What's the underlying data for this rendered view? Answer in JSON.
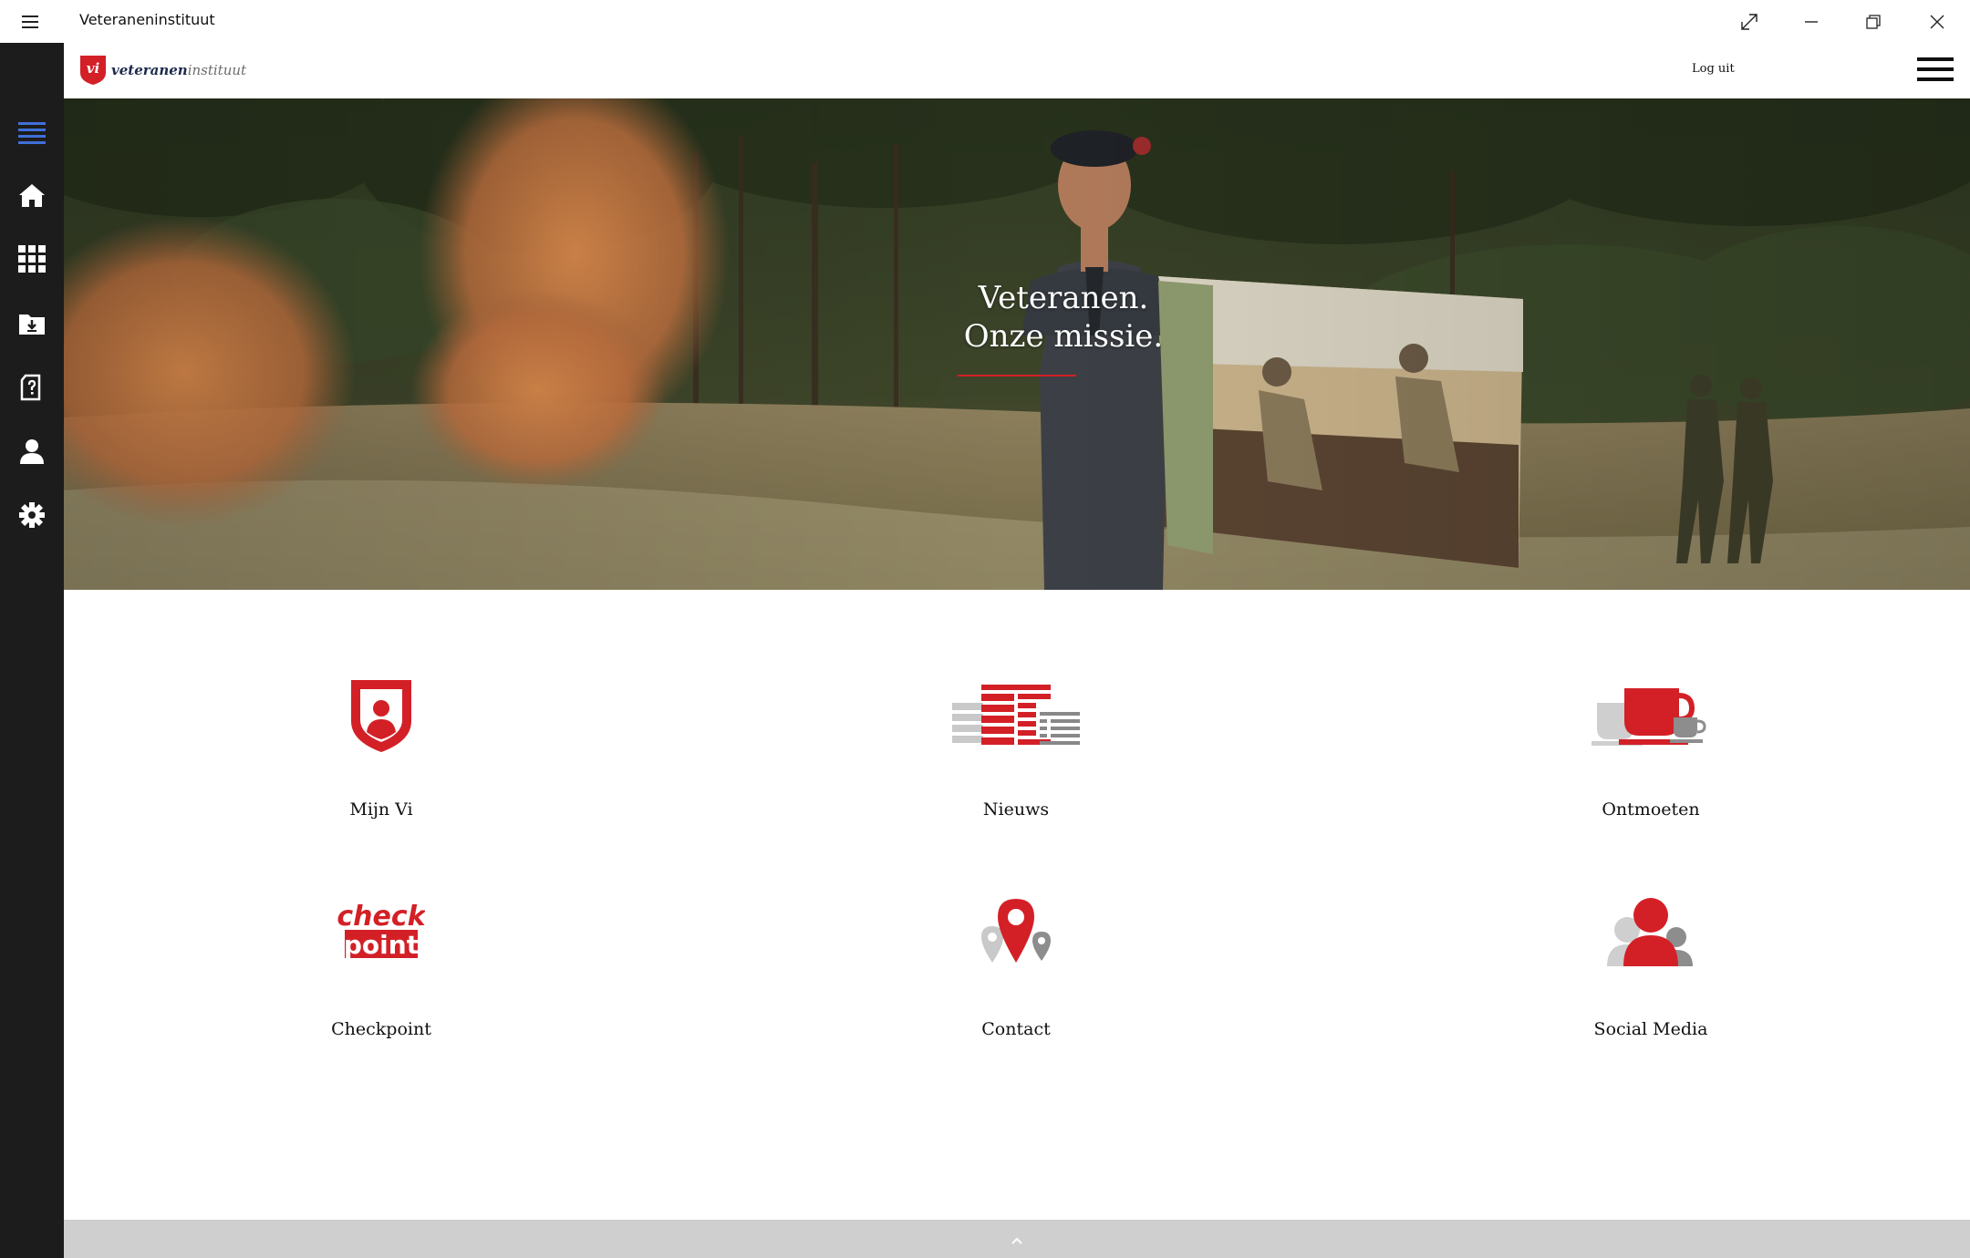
{
  "window": {
    "title": "Veteraneninstituut",
    "menu_icon": "hamburger-icon",
    "controls": [
      "expand-icon",
      "minimize-icon",
      "restore-icon",
      "close-icon"
    ]
  },
  "rail": {
    "items": [
      {
        "name": "menu",
        "icon": "list-icon",
        "active": true
      },
      {
        "name": "home",
        "icon": "home-icon"
      },
      {
        "name": "apps",
        "icon": "grid-icon"
      },
      {
        "name": "downloads",
        "icon": "download-folder-icon"
      },
      {
        "name": "faq",
        "icon": "document-question-icon"
      },
      {
        "name": "profile",
        "icon": "user-icon"
      },
      {
        "name": "settings",
        "icon": "gear-icon"
      }
    ]
  },
  "header": {
    "logo_mark": "vi",
    "logo_text_bold": "veteranen",
    "logo_text_light": "instituut",
    "logout_label": "Log uit"
  },
  "hero": {
    "line1": "Veteranen.",
    "line2": "Onze missie."
  },
  "tiles": [
    {
      "label": "Mijn Vi",
      "icon": "shield-user-icon"
    },
    {
      "label": "Nieuws",
      "icon": "newspaper-icon"
    },
    {
      "label": "Ontmoeten",
      "icon": "coffee-cup-icon"
    },
    {
      "label": "Checkpoint",
      "icon": "checkpoint-logo-icon",
      "logo_line1": "check",
      "logo_line2": "point"
    },
    {
      "label": "Contact",
      "icon": "map-pins-icon"
    },
    {
      "label": "Social Media",
      "icon": "people-icon"
    }
  ],
  "colors": {
    "accent": "#d32027",
    "rail": "#1c1c1c",
    "rail_active": "#3f6fd8",
    "logo_navy": "#1d2a4d",
    "grey_icon": "#b5b5b5"
  },
  "footer": {
    "icon": "chevron-up-icon"
  }
}
